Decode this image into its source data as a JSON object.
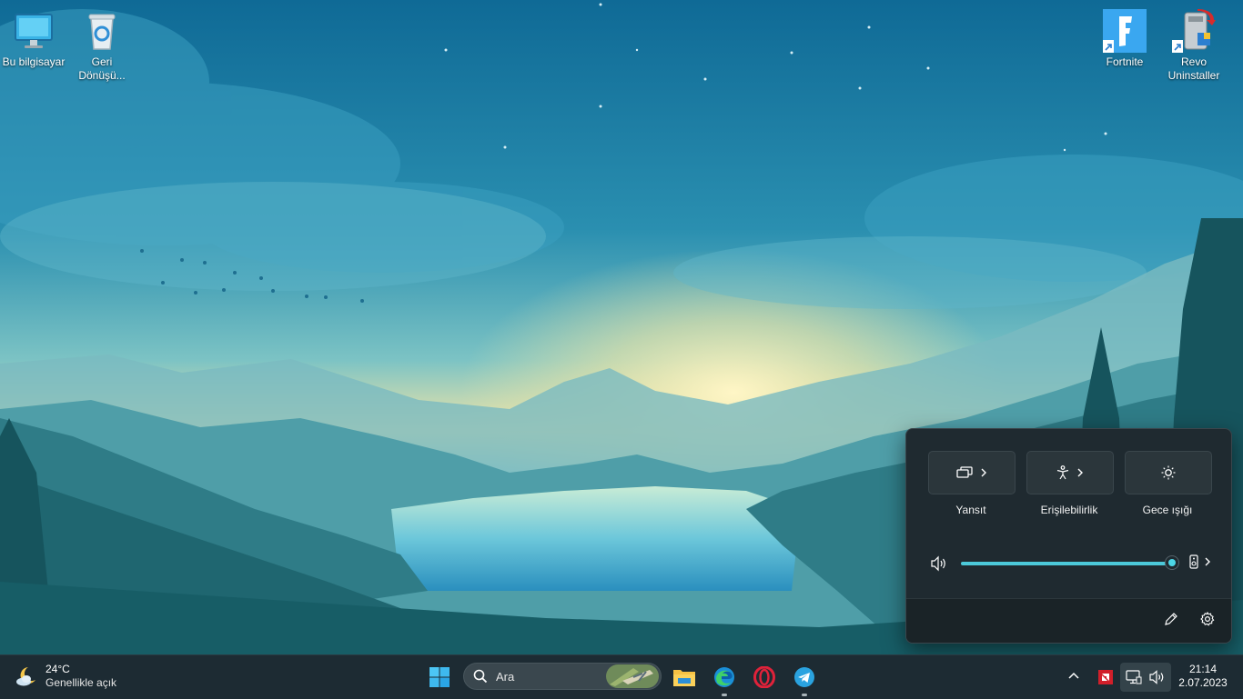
{
  "desktop": {
    "icons": [
      {
        "label": "Bu bilgisayar",
        "icon": "computer-icon"
      },
      {
        "label": "Geri Dönüşü...",
        "icon": "recycle-bin-icon"
      },
      {
        "label": "Fortnite",
        "icon": "fortnite-icon"
      },
      {
        "label": "Revo Uninstaller",
        "icon": "revo-uninstaller-icon"
      }
    ]
  },
  "quick_settings": {
    "tiles": [
      {
        "label": "Yansıt",
        "icon": "project-icon"
      },
      {
        "label": "Erişilebilirlik",
        "icon": "accessibility-icon"
      },
      {
        "label": "Gece ışığı",
        "icon": "night-light-icon"
      }
    ],
    "volume": {
      "level": 1.0,
      "icon": "speaker-icon",
      "output_icon": "audio-output-icon"
    },
    "footer": {
      "edit_icon": "pencil-icon",
      "settings_icon": "gear-icon"
    }
  },
  "taskbar": {
    "weather": {
      "temp": "24°C",
      "condition": "Genellikle açık",
      "icon": "moon-cloud-icon"
    },
    "search": {
      "placeholder": "Ara"
    },
    "apps": [
      "start-icon",
      "file-explorer-icon",
      "edge-icon",
      "opera-icon",
      "telegram-icon"
    ],
    "tray": {
      "clock_time": "21:14",
      "clock_date": "2.07.2023"
    }
  },
  "colors": {
    "accent": "#4cd6e6",
    "panel": "#1f2a30",
    "taskbar": "#1d2b33"
  }
}
